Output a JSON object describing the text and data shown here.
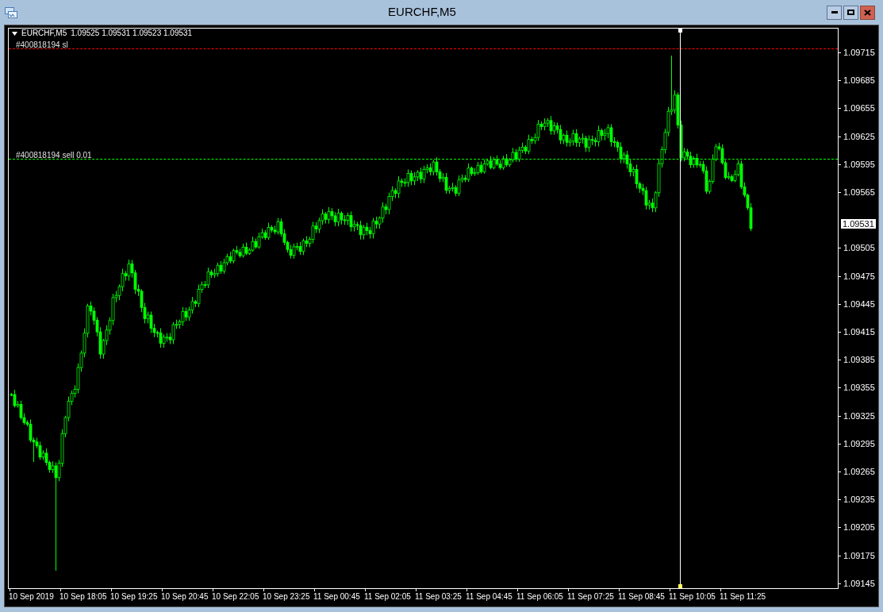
{
  "window": {
    "title": "EURCHF,M5"
  },
  "chart": {
    "symbol": "EURCHF,M5",
    "ohlc": "1.09525 1.09531 1.09523 1.09531",
    "order_lines": [
      {
        "kind": "stop_loss",
        "label": "#400818194 sl"
      },
      {
        "kind": "order",
        "label": "#400818194 sell 0.01"
      }
    ],
    "price_axis": [
      "1.09715",
      "1.09685",
      "1.09655",
      "1.09625",
      "1.09595",
      "1.09565",
      "1.09505",
      "1.09475",
      "1.09445",
      "1.09415",
      "1.09385",
      "1.09355",
      "1.09325",
      "1.09295",
      "1.09265",
      "1.09235",
      "1.09205",
      "1.09175",
      "1.09145"
    ],
    "current_price": "1.09531",
    "time_axis": [
      "10 Sep 2019",
      "10 Sep 18:05",
      "10 Sep 19:25",
      "10 Sep 20:45",
      "10 Sep 22:05",
      "10 Sep 23:25",
      "11 Sep 00:45",
      "11 Sep 02:05",
      "11 Sep 03:25",
      "11 Sep 04:45",
      "11 Sep 06:05",
      "11 Sep 07:25",
      "11 Sep 08:45",
      "11 Sep 10:05",
      "11 Sep 11:25"
    ]
  }
}
